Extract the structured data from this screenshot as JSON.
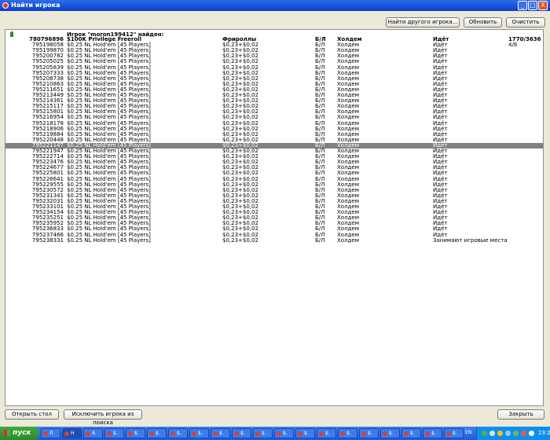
{
  "window": {
    "title": "Найти игрока",
    "minimize": "_",
    "maximize": "□",
    "close": "X"
  },
  "toolbar": {
    "find_other": "Найти другого игрока...",
    "refresh": "Обновить",
    "clear": "Очистить"
  },
  "list_header": "Игрок \"moron199412\" найден:",
  "rows": [
    {
      "id": "780796896",
      "name": "$100K Privilege Freeroll",
      "game": "Фрироллы",
      "limit": "Б/Л",
      "type": "Холдем",
      "status": "Идёт",
      "extra": "1770/3636",
      "bold": true
    },
    {
      "id": "795198058",
      "name": "$0.25 NL Hold'em [45 Players]",
      "game": "$0,23+$0,02",
      "limit": "Б/Л",
      "type": "Холдем",
      "status": "Идёт",
      "extra": "4/8"
    },
    {
      "id": "795199870",
      "name": "$0.25 NL Hold'em [45 Players]",
      "game": "$0,23+$0,02",
      "limit": "Б/Л",
      "type": "Холдем",
      "status": "Идёт",
      "extra": ""
    },
    {
      "id": "795200782",
      "name": "$0.25 NL Hold'em [45 Players]",
      "game": "$0,23+$0,02",
      "limit": "Б/Л",
      "type": "Холдем",
      "status": "Идёт",
      "extra": ""
    },
    {
      "id": "795205025",
      "name": "$0.25 NL Hold'em [45 Players]",
      "game": "$0,23+$0,02",
      "limit": "Б/Л",
      "type": "Холдем",
      "status": "Идёт",
      "extra": ""
    },
    {
      "id": "795205839",
      "name": "$0.25 NL Hold'em [45 Players]",
      "game": "$0,23+$0,02",
      "limit": "Б/Л",
      "type": "Холдем",
      "status": "Идёт",
      "extra": ""
    },
    {
      "id": "795207333",
      "name": "$0.25 NL Hold'em [45 Players]",
      "game": "$0,23+$0,02",
      "limit": "Б/Л",
      "type": "Холдем",
      "status": "Идёт",
      "extra": ""
    },
    {
      "id": "795208738",
      "name": "$0.25 NL Hold'em [45 Players]",
      "game": "$0,23+$0,02",
      "limit": "Б/Л",
      "type": "Холдем",
      "status": "Идёт",
      "extra": ""
    },
    {
      "id": "795210863",
      "name": "$0.25 NL Hold'em [45 Players]",
      "game": "$0,23+$0,02",
      "limit": "Б/Л",
      "type": "Холдем",
      "status": "Идёт",
      "extra": ""
    },
    {
      "id": "795211651",
      "name": "$0.25 NL Hold'em [45 Players]",
      "game": "$0,23+$0,02",
      "limit": "Б/Л",
      "type": "Холдем",
      "status": "Идёт",
      "extra": ""
    },
    {
      "id": "795213449",
      "name": "$0.25 NL Hold'em [45 Players]",
      "game": "$0,23+$0,02",
      "limit": "Б/Л",
      "type": "Холдем",
      "status": "Идёт",
      "extra": ""
    },
    {
      "id": "795214361",
      "name": "$0.25 NL Hold'em [45 Players]",
      "game": "$0,23+$0,02",
      "limit": "Б/Л",
      "type": "Холдем",
      "status": "Идёт",
      "extra": ""
    },
    {
      "id": "795215117",
      "name": "$0.25 NL Hold'em [45 Players]",
      "game": "$0,23+$0,02",
      "limit": "Б/Л",
      "type": "Холдем",
      "status": "Идёт",
      "extra": ""
    },
    {
      "id": "795215801",
      "name": "$0.25 NL Hold'em [45 Players]",
      "game": "$0,23+$0,02",
      "limit": "Б/Л",
      "type": "Холдем",
      "status": "Идёт",
      "extra": ""
    },
    {
      "id": "795216954",
      "name": "$0.25 NL Hold'em [45 Players]",
      "game": "$0,23+$0,02",
      "limit": "Б/Л",
      "type": "Холдем",
      "status": "Идёт",
      "extra": ""
    },
    {
      "id": "795218178",
      "name": "$0.25 NL Hold'em [45 Players]",
      "game": "$0,23+$0,02",
      "limit": "Б/Л",
      "type": "Холдем",
      "status": "Идёт",
      "extra": ""
    },
    {
      "id": "795218906",
      "name": "$0.25 NL Hold'em [45 Players]",
      "game": "$0,23+$0,02",
      "limit": "Б/Л",
      "type": "Холдем",
      "status": "Идёт",
      "extra": ""
    },
    {
      "id": "795219884",
      "name": "$0.25 NL Hold'em [45 Players]",
      "game": "$0,23+$0,02",
      "limit": "Б/Л",
      "type": "Холдем",
      "status": "Идёт",
      "extra": ""
    },
    {
      "id": "795220448",
      "name": "$0.25 NL Hold'em [45 Players]",
      "game": "$0,23+$0,02",
      "limit": "Б/Л",
      "type": "Холдем",
      "status": "Идёт",
      "extra": ""
    },
    {
      "id": "795221147",
      "name": "$0.25 NL Hold'em [45 Players]",
      "game": "$0,23+$0,02",
      "limit": "Б/Л",
      "type": "Холдем",
      "status": "Идёт",
      "extra": "",
      "selected": true
    },
    {
      "id": "795221947",
      "name": "$0.25 NL Hold'em [45 Players]",
      "game": "$0,23+$0,02",
      "limit": "Б/Л",
      "type": "Холдем",
      "status": "Идёт",
      "extra": ""
    },
    {
      "id": "795222714",
      "name": "$0.25 NL Hold'em [45 Players]",
      "game": "$0,23+$0,02",
      "limit": "Б/Л",
      "type": "Холдем",
      "status": "Идёт",
      "extra": ""
    },
    {
      "id": "795223476",
      "name": "$0.25 NL Hold'em [45 Players]",
      "game": "$0,23+$0,02",
      "limit": "Б/Л",
      "type": "Холдем",
      "status": "Идёт",
      "extra": ""
    },
    {
      "id": "795224677",
      "name": "$0.25 NL Hold'em [45 Players]",
      "game": "$0,23+$0,02",
      "limit": "Б/Л",
      "type": "Холдем",
      "status": "Идёт",
      "extra": ""
    },
    {
      "id": "795225801",
      "name": "$0.25 NL Hold'em [45 Players]",
      "game": "$0,23+$0,02",
      "limit": "Б/Л",
      "type": "Холдем",
      "status": "Идёт",
      "extra": ""
    },
    {
      "id": "795226641",
      "name": "$0.25 NL Hold'em [45 Players]",
      "game": "$0,23+$0,02",
      "limit": "Б/Л",
      "type": "Холдем",
      "status": "Идёт",
      "extra": ""
    },
    {
      "id": "795229555",
      "name": "$0.25 NL Hold'em [45 Players]",
      "game": "$0,23+$0,02",
      "limit": "Б/Л",
      "type": "Холдем",
      "status": "Идёт",
      "extra": ""
    },
    {
      "id": "795230572",
      "name": "$0.25 NL Hold'em [45 Players]",
      "game": "$0,23+$0,02",
      "limit": "Б/Л",
      "type": "Холдем",
      "status": "Идёт",
      "extra": ""
    },
    {
      "id": "795231341",
      "name": "$0.25 NL Hold'em [45 Players]",
      "game": "$0,23+$0,02",
      "limit": "Б/Л",
      "type": "Холдем",
      "status": "Идёт",
      "extra": ""
    },
    {
      "id": "795232031",
      "name": "$0.25 NL Hold'em [45 Players]",
      "game": "$0,23+$0,02",
      "limit": "Б/Л",
      "type": "Холдем",
      "status": "Идёт",
      "extra": ""
    },
    {
      "id": "795233101",
      "name": "$0.25 NL Hold'em [45 Players]",
      "game": "$0,23+$0,02",
      "limit": "Б/Л",
      "type": "Холдем",
      "status": "Идёт",
      "extra": ""
    },
    {
      "id": "795234154",
      "name": "$0.25 NL Hold'em [45 Players]",
      "game": "$0,23+$0,02",
      "limit": "Б/Л",
      "type": "Холдем",
      "status": "Идёт",
      "extra": ""
    },
    {
      "id": "795235251",
      "name": "$0.25 NL Hold'em [45 Players]",
      "game": "$0,23+$0,02",
      "limit": "Б/Л",
      "type": "Холдем",
      "status": "Идёт",
      "extra": ""
    },
    {
      "id": "795235952",
      "name": "$0.25 NL Hold'em [45 Players]",
      "game": "$0,23+$0,02",
      "limit": "Б/Л",
      "type": "Холдем",
      "status": "Идёт",
      "extra": ""
    },
    {
      "id": "795236833",
      "name": "$0.25 NL Hold'em [45 Players]",
      "game": "$0,23+$0,02",
      "limit": "Б/Л",
      "type": "Холдем",
      "status": "Идёт",
      "extra": ""
    },
    {
      "id": "795237466",
      "name": "$0.25 NL Hold'em [45 Players]",
      "game": "$0,23+$0,02",
      "limit": "Б/Л",
      "type": "Холдем",
      "status": "Идёт",
      "extra": ""
    },
    {
      "id": "795238331",
      "name": "$0.25 NL Hold'em [45 Players]",
      "game": "$0,23+$0,02",
      "limit": "Б/Л",
      "type": "Холдем",
      "status": "Занимают игровые места",
      "extra": ""
    }
  ],
  "bottom": {
    "open_table": "Открыть стол",
    "exclude_player": "Исключить игрока из поиска",
    "close": "Закрыть"
  },
  "taskbar": {
    "start_label": "пуск",
    "tasks": [
      "Л",
      "Н",
      "А",
      "$.",
      "$.",
      "$.",
      "$.",
      "$.",
      "$.",
      "$.",
      "$.",
      "$.",
      "$.",
      "$.",
      "$.",
      "$.",
      "$.",
      "$.",
      "$.",
      "$."
    ],
    "active_task": 1,
    "lang": "EN",
    "clock": "23:21"
  },
  "colors": {
    "selected_row": "#808080",
    "title_bar": "#0A3FC8",
    "window_bg": "#ECE9D8"
  }
}
